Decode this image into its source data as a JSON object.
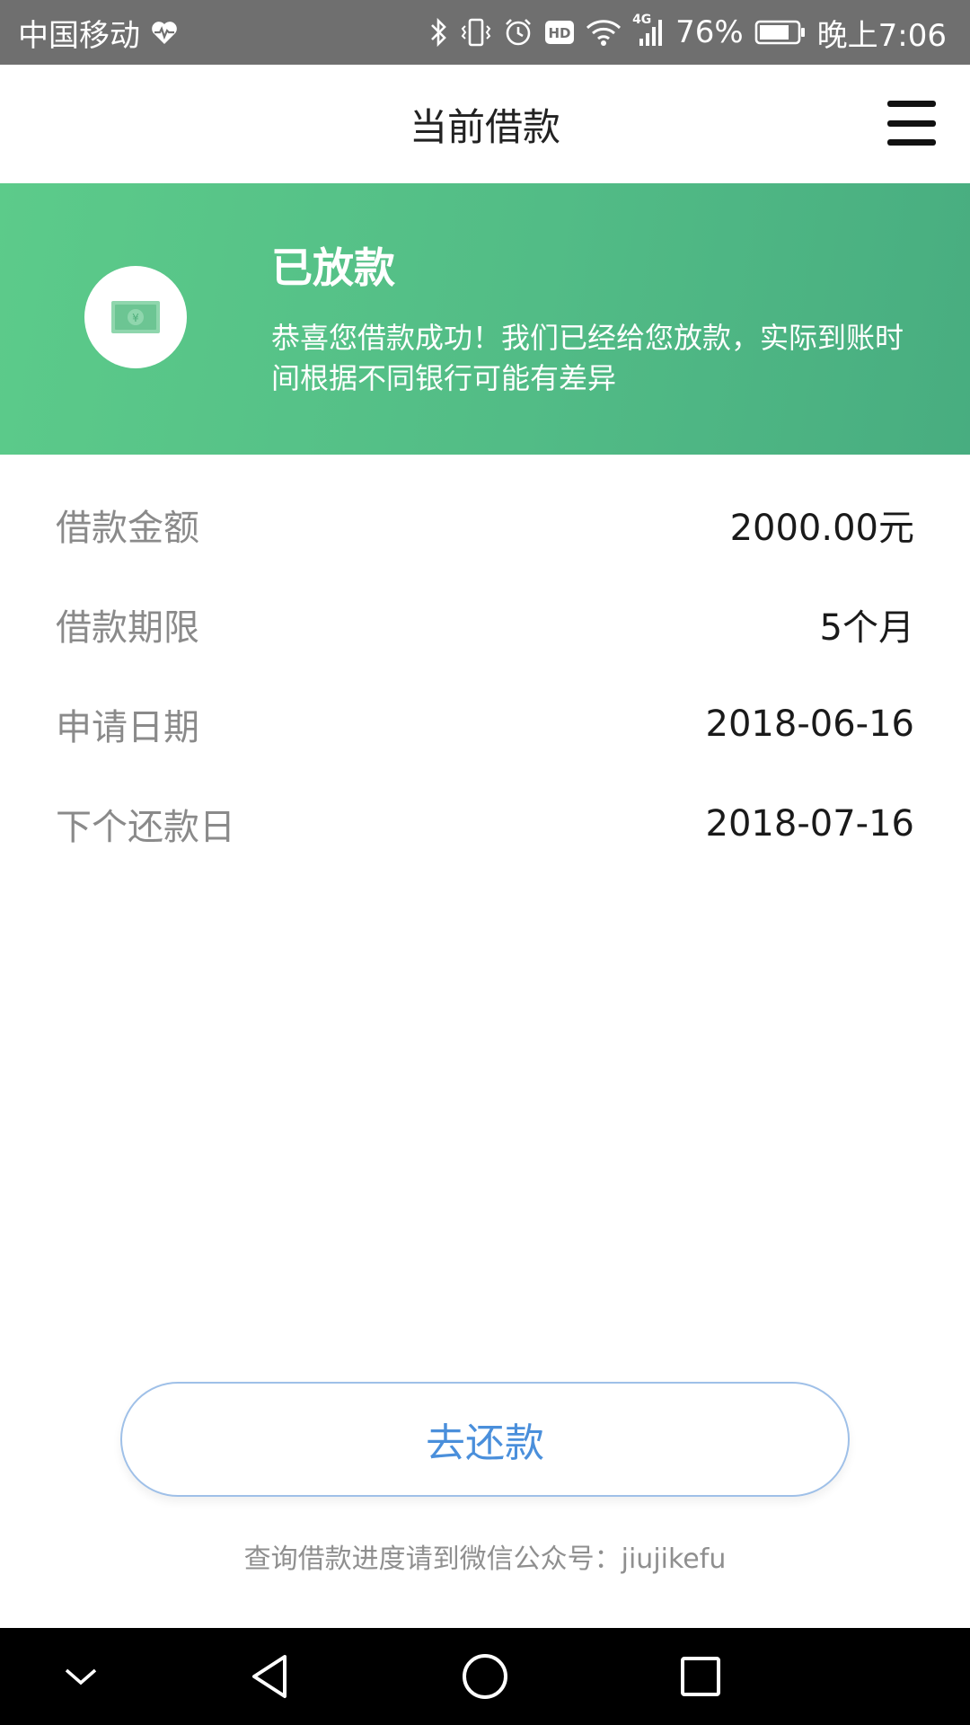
{
  "status_bar": {
    "carrier": "中国移动",
    "network": "4G",
    "battery": "76%",
    "time": "晚上7:06",
    "icons": [
      "heart-rate-icon",
      "bluetooth-icon",
      "vibrate-icon",
      "alarm-icon",
      "hd-icon",
      "wifi-icon",
      "signal-icon",
      "battery-icon"
    ]
  },
  "header": {
    "title": "当前借款",
    "menu_icon": "hamburger-menu-icon"
  },
  "banner": {
    "icon": "money-bill-icon",
    "title": "已放款",
    "message": "恭喜您借款成功！我们已经给您放款，实际到账时间根据不同银行可能有差异",
    "colors": {
      "start": "#5ccb8a",
      "end": "#48ad80"
    }
  },
  "details": [
    {
      "label": "借款金额",
      "value": "2000.00元"
    },
    {
      "label": "借款期限",
      "value": "5个月"
    },
    {
      "label": "申请日期",
      "value": "2018-06-16"
    },
    {
      "label": "下个还款日",
      "value": "2018-07-16"
    }
  ],
  "actions": {
    "repay_label": "去还款",
    "accent_color": "#4a8fdb"
  },
  "footer": {
    "note": "查询借款进度请到微信公众号：jiujikefu"
  },
  "nav_bar": {
    "buttons": [
      "collapse-icon",
      "back-icon",
      "home-icon",
      "recents-icon"
    ]
  }
}
